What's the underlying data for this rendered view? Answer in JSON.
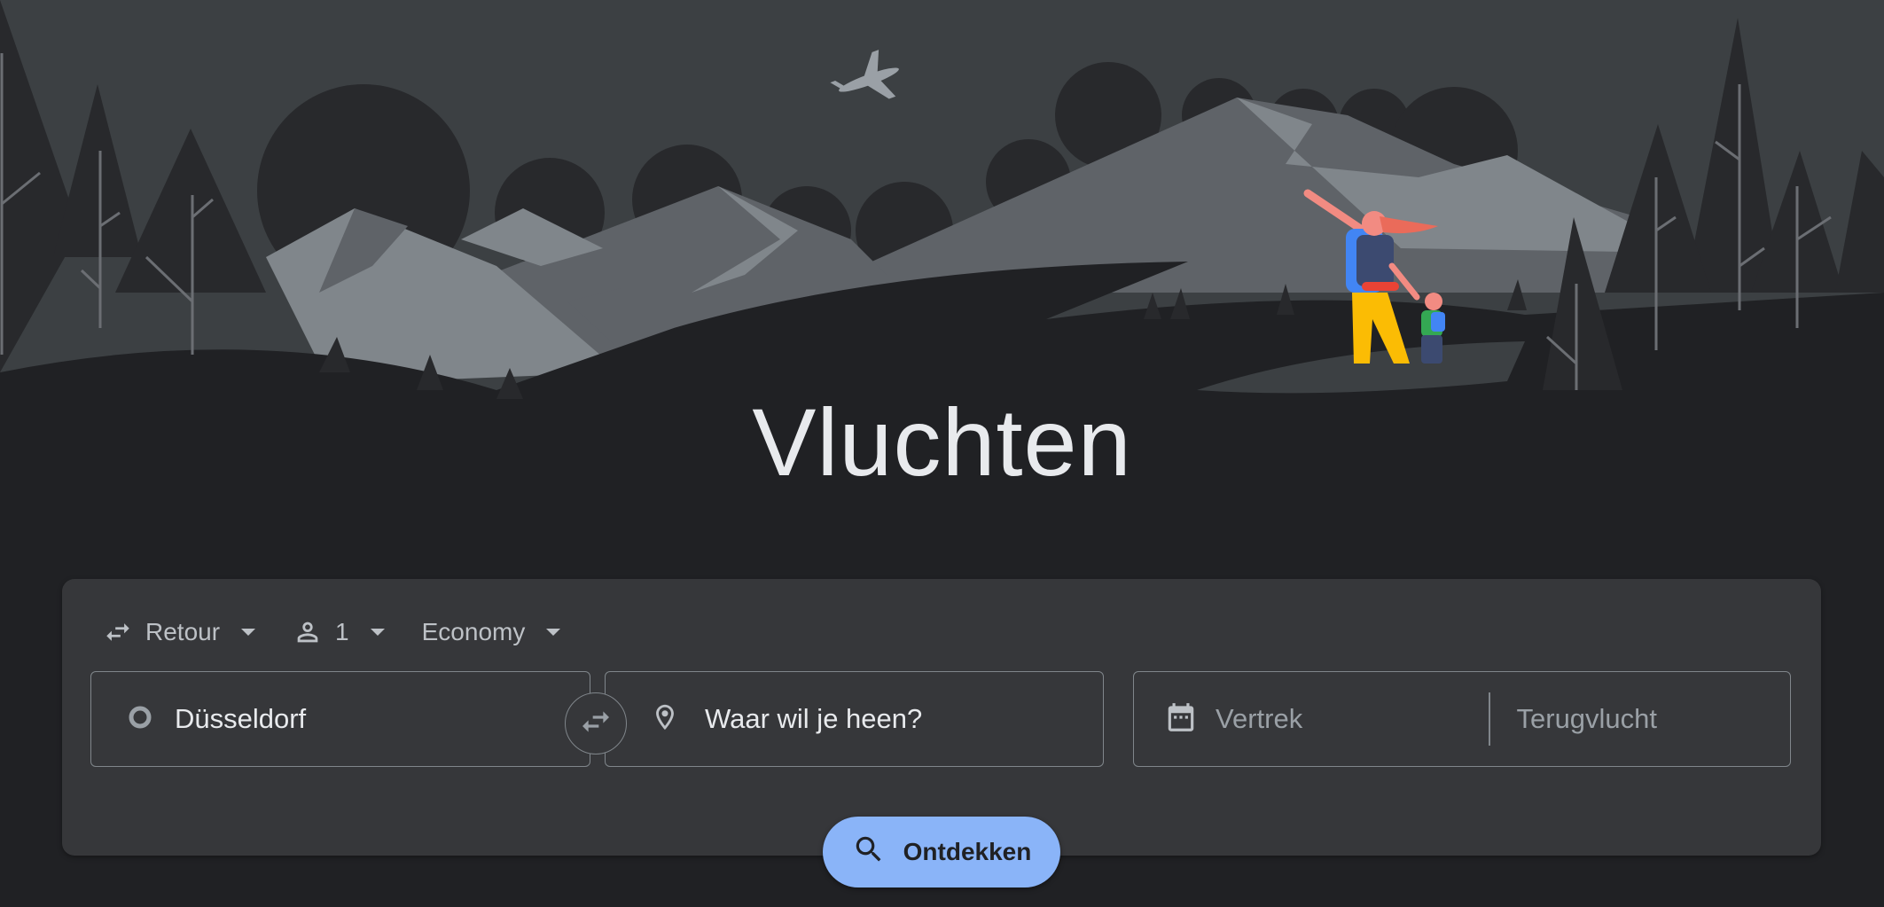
{
  "hero": {
    "title": "Vluchten"
  },
  "trip_options": {
    "trip_type": {
      "label": "Retour",
      "icon": "swap-horizontal-icon"
    },
    "passengers": {
      "label": "1",
      "icon": "person-icon"
    },
    "cabin_class": {
      "label": "Economy"
    }
  },
  "fields": {
    "origin": {
      "value": "Düsseldorf",
      "icon": "circle-outline-icon"
    },
    "destination": {
      "placeholder": "Waar wil je heen?",
      "icon": "location-pin-icon"
    },
    "departure": {
      "placeholder": "Vertrek",
      "icon": "calendar-icon"
    },
    "return": {
      "placeholder": "Terugvlucht"
    }
  },
  "explore_button": {
    "label": "Ontdekken",
    "icon": "search-icon"
  },
  "colors": {
    "background": "#202124",
    "card": "#36373a",
    "accent": "#8ab4f8",
    "text": "#e8eaed",
    "muted": "#9aa0a6"
  }
}
